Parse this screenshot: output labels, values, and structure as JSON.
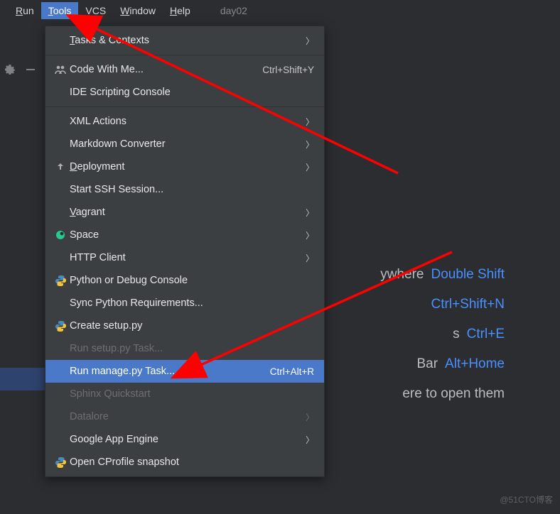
{
  "menubar": {
    "run": "Run",
    "tools": "Tools",
    "vcs": "VCS",
    "window": "Window",
    "help": "Help",
    "project": "day02"
  },
  "menu": {
    "tasks": "Tasks & Contexts",
    "code_with_me": "Code With Me...",
    "code_with_me_short": "Ctrl+Shift+Y",
    "ide_script": "IDE Scripting Console",
    "xml": "XML Actions",
    "markdown": "Markdown Converter",
    "deployment": "Deployment",
    "ssh": "Start SSH Session...",
    "vagrant": "Vagrant",
    "space": "Space",
    "http": "HTTP Client",
    "py_console": "Python or Debug Console",
    "sync_req": "Sync Python Requirements...",
    "create_setup": "Create setup.py",
    "run_setup": "Run setup.py Task...",
    "run_manage": "Run manage.py Task...",
    "run_manage_short": "Ctrl+Alt+R",
    "sphinx": "Sphinx Quickstart",
    "datalore": "Datalore",
    "gae": "Google App Engine",
    "cprofile": "Open CProfile snapshot"
  },
  "hints": {
    "r1_label": "ywhere",
    "r1_kb": "Double Shift",
    "r2_kb": "Ctrl+Shift+N",
    "r3_label": "s",
    "r3_kb": "Ctrl+E",
    "r4_label": "Bar",
    "r4_kb": "Alt+Home",
    "r5_label": "ere to open them"
  },
  "watermark": "@51CTO博客"
}
